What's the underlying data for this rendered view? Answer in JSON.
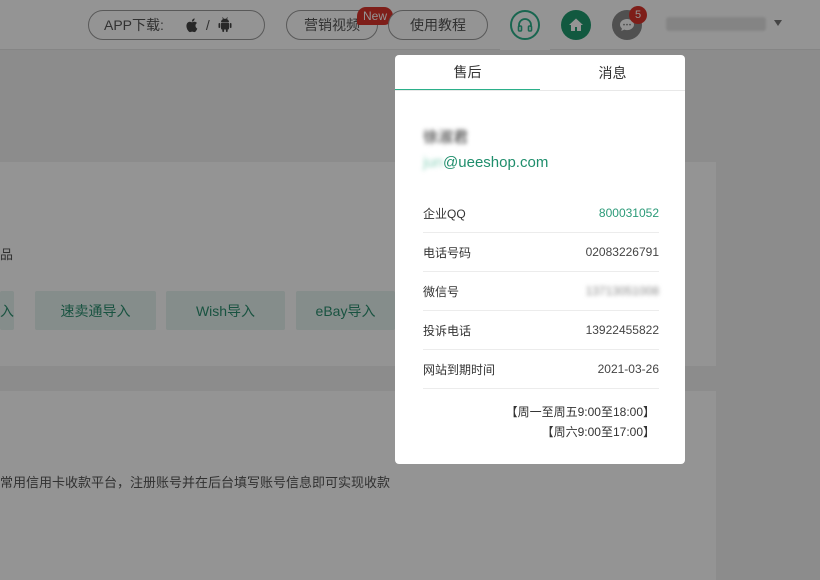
{
  "header": {
    "app_label": "APP下载:",
    "slash": "/",
    "video_label": "营销视频",
    "new_badge": "New",
    "tutorial_label": "使用教程",
    "msg_count": "5"
  },
  "background": {
    "fragment_1": "品",
    "import_buttons": [
      "入",
      "速卖通导入",
      "Wish导入",
      "eBay导入"
    ],
    "payment_text": "常用信用卡收款平台，注册账号并在后台填写账号信息即可实现收款"
  },
  "popup": {
    "tabs": [
      "售后",
      "消息"
    ],
    "agent_name": "徐淑君",
    "email_prefix": "jun",
    "email_domain": "@ueeshop.com",
    "rows": [
      {
        "key": "企业QQ",
        "value": "800031052"
      },
      {
        "key": "电话号码",
        "value": "02083226791"
      },
      {
        "key": "微信号",
        "value": "13713051008"
      },
      {
        "key": "投诉电话",
        "value": "13922455822"
      },
      {
        "key": "网站到期时间",
        "value": "2021-03-26"
      }
    ],
    "hours": [
      "【周一至周五9:00至18:00】",
      "【周六9:00至17:00】"
    ]
  },
  "colors": {
    "accent": "#2bb08a",
    "badge": "#d9342b",
    "home": "#1f9a6e"
  }
}
